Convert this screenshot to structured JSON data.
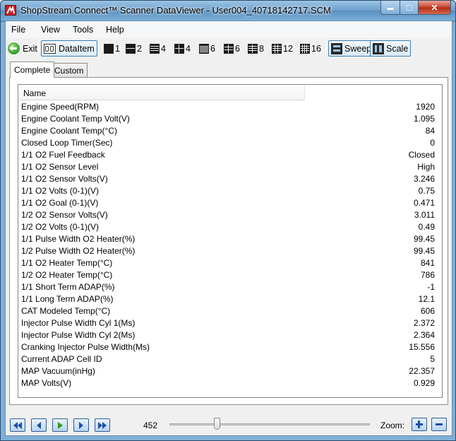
{
  "window": {
    "title": "ShopStream Connect™ Scanner DataViewer - User004_40718142717.SCM",
    "minimize_glyph": "▬",
    "maximize_glyph": "□",
    "close_glyph": "✕"
  },
  "menu": [
    "File",
    "View",
    "Tools",
    "Help"
  ],
  "toolbar": {
    "exit_label": "Exit",
    "dataitem_label": "DataItem",
    "layouts": [
      "1",
      "2",
      "4",
      "4",
      "6",
      "6",
      "8",
      "12",
      "16"
    ],
    "sweep_label": "Sweep",
    "scale_label": "Scale"
  },
  "tabs": [
    "Complete",
    "Custom"
  ],
  "table": {
    "header": "Name",
    "rows": [
      {
        "name": "Engine Speed(RPM)",
        "value": "1920"
      },
      {
        "name": "Engine Coolant Temp Volt(V)",
        "value": "1.095"
      },
      {
        "name": "Engine Coolant Temp(°C)",
        "value": "84"
      },
      {
        "name": "Closed Loop Timer(Sec)",
        "value": "0"
      },
      {
        "name": "1/1 O2 Fuel Feedback",
        "value": "Closed"
      },
      {
        "name": "1/1 O2 Sensor Level",
        "value": "High"
      },
      {
        "name": "1/1 O2 Sensor Volts(V)",
        "value": "3.246"
      },
      {
        "name": "1/1 O2 Volts (0-1)(V)",
        "value": "0.75"
      },
      {
        "name": "1/1 O2 Goal (0-1)(V)",
        "value": "0.471"
      },
      {
        "name": "1/2 O2 Sensor Volts(V)",
        "value": "3.011"
      },
      {
        "name": "1/2 O2 Volts (0-1)(V)",
        "value": "0.49"
      },
      {
        "name": "1/1 Pulse Width O2 Heater(%)",
        "value": "99.45"
      },
      {
        "name": "1/2 Pulse Width O2 Heater(%)",
        "value": "99.45"
      },
      {
        "name": "1/1 O2 Heater Temp(°C)",
        "value": "841"
      },
      {
        "name": "1/2 O2 Heater Temp(°C)",
        "value": "786"
      },
      {
        "name": "1/1 Short Term ADAP(%)",
        "value": "-1"
      },
      {
        "name": "1/1 Long Term ADAP(%)",
        "value": "12.1"
      },
      {
        "name": "CAT Modeled Temp(°C)",
        "value": "606"
      },
      {
        "name": "Injector Pulse Width Cyl 1(Ms)",
        "value": "2.372"
      },
      {
        "name": "Injector Pulse Width Cyl 2(Ms)",
        "value": "2.364"
      },
      {
        "name": "Cranking Injector Pulse Width(Ms)",
        "value": "15.556"
      },
      {
        "name": "Current ADAP Cell ID",
        "value": "5"
      },
      {
        "name": "MAP Vacuum(inHg)",
        "value": "22.357"
      },
      {
        "name": "MAP Volts(V)",
        "value": "0.929"
      }
    ]
  },
  "playback": {
    "frame": "452",
    "position_fraction": 0.24,
    "zoom_label": "Zoom:"
  },
  "colors": {
    "title_bar": "#6b9fcc",
    "close_button": "#c7442c",
    "nav_button_icon": "#1e4fa3",
    "play_button_icon": "#2f9b22"
  }
}
